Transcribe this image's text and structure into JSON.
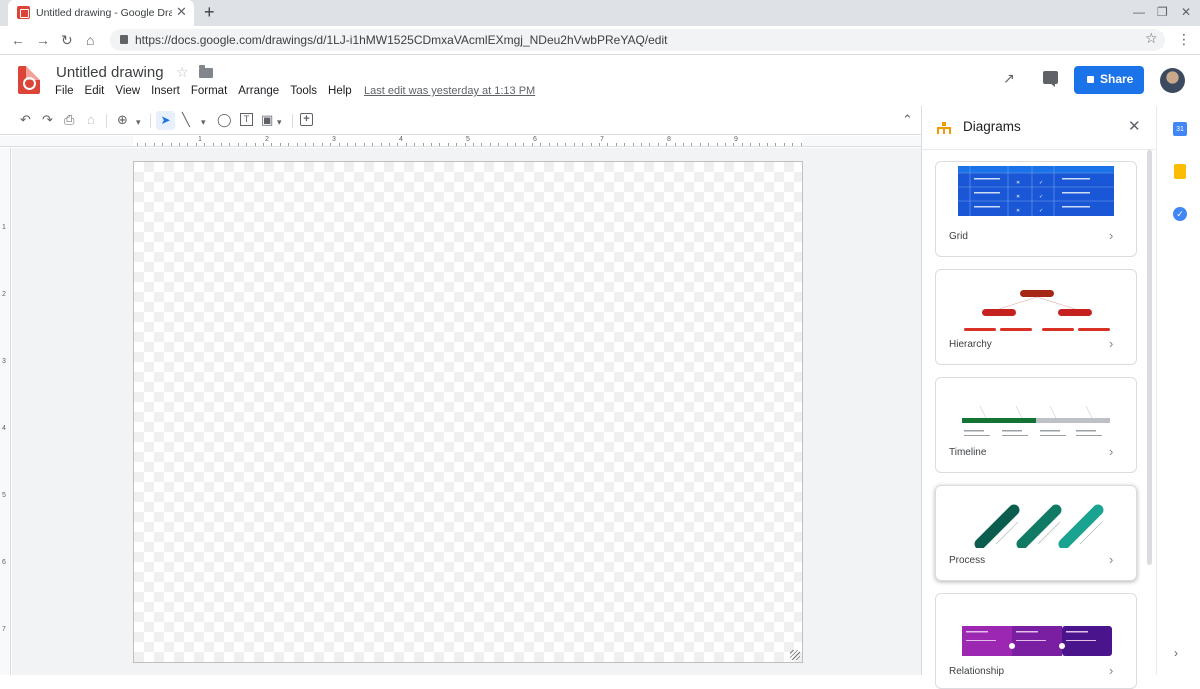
{
  "browser": {
    "tab_title": "Untitled drawing - Google Drawin",
    "tab_close": "✕",
    "new_tab": "+",
    "url": "https://docs.google.com/drawings/d/1LJ-i1hMW1525CDmxaVAcmlEXmgj_NDeu2hVwbPReYAQ/edit",
    "controls": {
      "minimize": "—",
      "restore": "❐",
      "close": "✕"
    },
    "nav": {
      "back": "←",
      "forward": "→",
      "reload": "↻",
      "home": "⌂"
    },
    "star": "☆",
    "menu": "⋮"
  },
  "app": {
    "doc_title": "Untitled drawing",
    "star": "☆",
    "menu": [
      "File",
      "Edit",
      "View",
      "Insert",
      "Format",
      "Arrange",
      "Tools",
      "Help"
    ],
    "last_edit": "Last edit was yesterday at 1:13 PM",
    "share_label": "Share",
    "accent": "#1a73e8",
    "brand": "#db4437"
  },
  "toolbar": {
    "undo": "↶",
    "redo": "↷",
    "print": "⎙",
    "paint": "⌂",
    "zoom": "⊕",
    "dropdown": "▾",
    "select": "➤",
    "line": "╲",
    "shape": "◯",
    "textbox": "T",
    "image": "▣",
    "comment": "+"
  },
  "ruler": {
    "h_numbers": [
      "1",
      "2",
      "3",
      "4",
      "5",
      "6",
      "7",
      "8",
      "9"
    ],
    "v_numbers": [
      "1",
      "2",
      "3",
      "4",
      "5",
      "6",
      "7"
    ]
  },
  "panel": {
    "title": "Diagrams",
    "close": "✕",
    "arrow": "›",
    "cards": [
      {
        "label": "Grid"
      },
      {
        "label": "Hierarchy"
      },
      {
        "label": "Timeline"
      },
      {
        "label": "Process"
      },
      {
        "label": "Relationship"
      }
    ]
  },
  "side_strip": {
    "calendar_text": "31",
    "tasks_text": "✓",
    "expand": "›"
  }
}
